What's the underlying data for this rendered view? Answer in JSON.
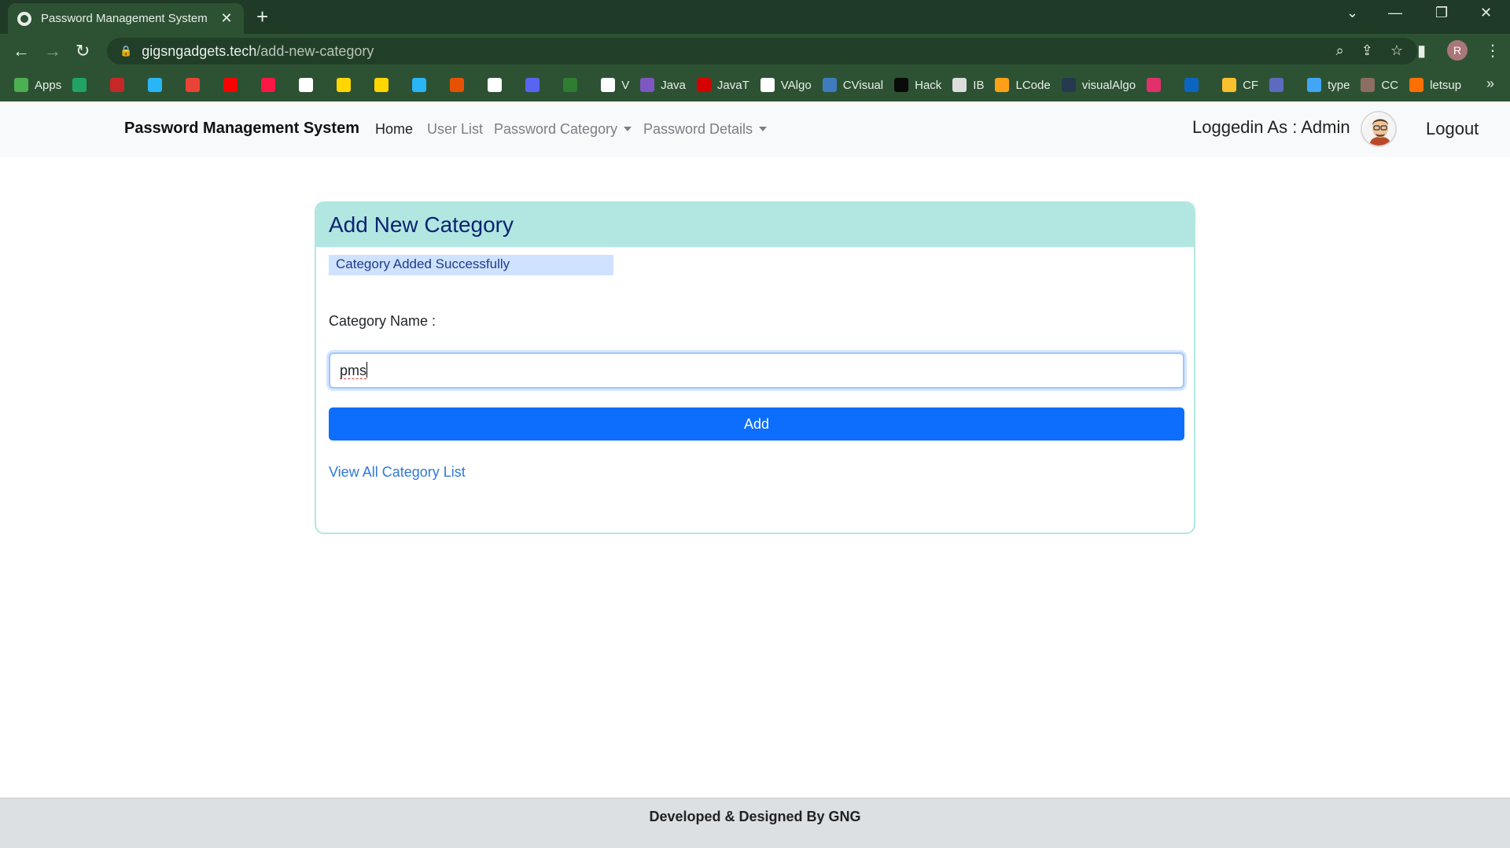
{
  "browser": {
    "tab_title": "Password Management System",
    "tab_close": "✕",
    "new_tab": "+",
    "url_domain": "gigsngadgets.tech",
    "url_path": "/add-new-category",
    "profile_initial": "R",
    "bookmarks": [
      {
        "label": "Apps",
        "color": "#4caf50"
      },
      {
        "label": "",
        "color": "#21a366"
      },
      {
        "label": "",
        "color": "#c62828"
      },
      {
        "label": "",
        "color": "#29b6f6"
      },
      {
        "label": "",
        "color": "#ea4335"
      },
      {
        "label": "",
        "color": "#ff0000"
      },
      {
        "label": "",
        "color": "#ff1744"
      },
      {
        "label": "",
        "color": "#ffffff"
      },
      {
        "label": "",
        "color": "#ffd600"
      },
      {
        "label": "",
        "color": "#ffd600"
      },
      {
        "label": "",
        "color": "#29b6f6"
      },
      {
        "label": "",
        "color": "#e65100"
      },
      {
        "label": "",
        "color": "#ffffff"
      },
      {
        "label": "",
        "color": "#5865f2"
      },
      {
        "label": "",
        "color": "#2e7d32"
      },
      {
        "label": "V",
        "color": "#ffffff"
      },
      {
        "label": "Java",
        "color": "#7e57c2"
      },
      {
        "label": "JavaT",
        "color": "#d50000"
      },
      {
        "label": "VAlgo",
        "color": "#ffffff"
      },
      {
        "label": "CVisual",
        "color": "#3f7cbf"
      },
      {
        "label": "Hack",
        "color": "#0a0a0a"
      },
      {
        "label": "IB",
        "color": "#dddddd"
      },
      {
        "label": "LCode",
        "color": "#ffa116"
      },
      {
        "label": "visualAlgo",
        "color": "#253a4f"
      },
      {
        "label": "",
        "color": "#e1306c"
      },
      {
        "label": "",
        "color": "#0a66c2"
      },
      {
        "label": "CF",
        "color": "#fbc02d"
      },
      {
        "label": "",
        "color": "#5c6bc0"
      },
      {
        "label": "type",
        "color": "#42a5f5"
      },
      {
        "label": "CC",
        "color": "#8d6e63"
      },
      {
        "label": "letsup",
        "color": "#ff6f00"
      }
    ],
    "bookmarks_more": "»"
  },
  "navbar": {
    "brand": "Password Management System",
    "links": {
      "home": "Home",
      "user_list": "User List",
      "password_category": "Password Category",
      "password_details": "Password Details"
    },
    "logged_in_text": "Loggedin As : Admin",
    "logout": "Logout"
  },
  "card": {
    "title": "Add New Category",
    "alert": "Category Added Successfully",
    "field_label": "Category Name :",
    "field_value": "pms",
    "button": "Add",
    "view_link": "View All Category List"
  },
  "footer": {
    "text": "Developed & Designed By GNG"
  },
  "colors": {
    "primary_button": "#0d6efd",
    "card_header": "#b2e6e1",
    "alert_bg": "#cfe2ff",
    "chrome_bg": "#2d5233"
  }
}
